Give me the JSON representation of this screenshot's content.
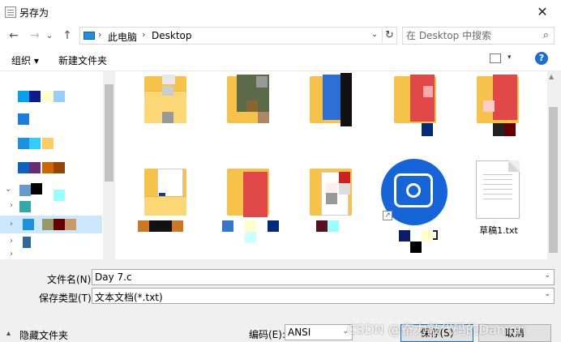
{
  "window": {
    "title": "另存为",
    "close_glyph": "✕"
  },
  "nav": {
    "back_glyph": "←",
    "forward_glyph": "→",
    "recent_glyph": "⌄",
    "up_glyph": "↑",
    "breadcrumb": [
      "此电脑",
      "Desktop"
    ],
    "sep_glyph": "›",
    "dropdown_glyph": "⌄",
    "refresh_glyph": "↻"
  },
  "search": {
    "placeholder": "在 Desktop 中搜索",
    "icon_glyph": "⌕"
  },
  "toolbar": {
    "organize_label": "组织 ▾",
    "new_folder_label": "新建文件夹",
    "view_drop_glyph": "▾",
    "help_glyph": "?"
  },
  "files": {
    "txt_file_label": "草稿1.txt",
    "app_shortcut_arrow": "↗"
  },
  "form": {
    "filename_label": "文件名(N):",
    "filename_value": "Day 7.c",
    "filetype_label": "保存类型(T):",
    "filetype_value": "文本文档(*.txt)",
    "dropdown_glyph": "⌄"
  },
  "footer": {
    "hide_folders_label": "隐藏文件夹",
    "hide_folders_arrow": "▴",
    "encoding_label": "编码(E):",
    "encoding_value": "ANSI",
    "save_label": "保存(S)",
    "cancel_label": "取消"
  },
  "watermark": "CSDN @奋力敲代码的Damon",
  "colors": {
    "accent": "#0078d7",
    "folder": "#f5c24a",
    "selection": "#cce8ff"
  }
}
